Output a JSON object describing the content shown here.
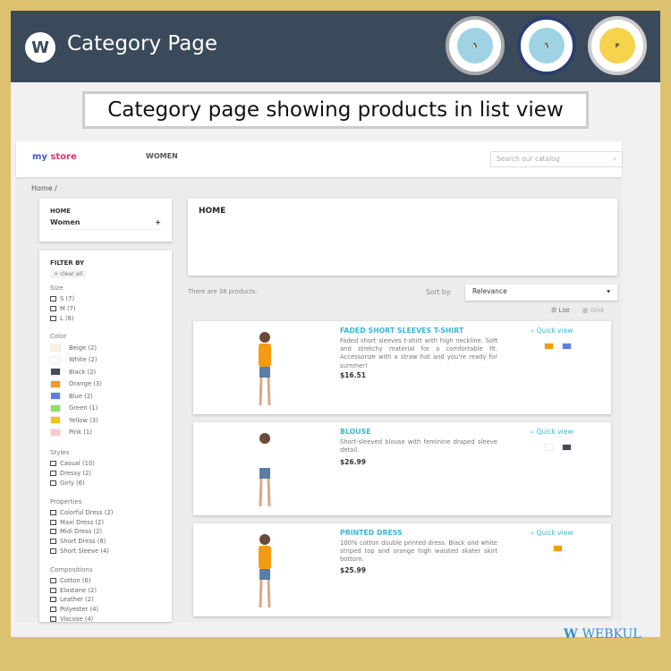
{
  "header": {
    "title": "Category Page",
    "logo": "W",
    "badges": [
      "PrestaShop Partner Silver",
      "PrestaShop Partner Module Developer",
      "PrestaShop Super Hero Seller"
    ]
  },
  "caption": "Category page showing products in list view",
  "store": {
    "brand_a": "my ",
    "brand_b": "store",
    "nav": "WOMEN",
    "search_placeholder": "Search our catalog",
    "breadcrumb": "Home  /"
  },
  "category_block": {
    "title": "HOME",
    "item": "Women",
    "plus": "+"
  },
  "filters": {
    "title": "FILTER BY",
    "clear": "×   clear all",
    "groups": [
      {
        "name": "Size",
        "items": [
          "S (7)",
          "M (7)",
          "L (8)"
        ]
      },
      {
        "name": "Color",
        "items": [
          "Beige (2)",
          "White (2)",
          "Black (2)",
          "Orange (3)",
          "Blue (2)",
          "Green (1)",
          "Yellow (3)",
          "Pink (1)"
        ],
        "colors": [
          "#f5f5dc",
          "#ffffff",
          "#434a54",
          "#f39c11",
          "#5d7ee8",
          "#8dde6b",
          "#f1c40f",
          "#fcc9cc"
        ]
      },
      {
        "name": "Styles",
        "items": [
          "Casual (10)",
          "Dressy (2)",
          "Girly (6)"
        ]
      },
      {
        "name": "Properties",
        "items": [
          "Colorful Dress (2)",
          "Maxi Dress (2)",
          "Midi Dress (2)",
          "Short Dress (6)",
          "Short Sleeve (4)"
        ]
      },
      {
        "name": "Compositions",
        "items": [
          "Cotton (6)",
          "Elastane (2)",
          "Leather (2)",
          "Polyester (4)",
          "Viscose (4)"
        ]
      }
    ]
  },
  "main": {
    "heading": "HOME",
    "count": "There are 38 products.",
    "sort_label": "Sort by:",
    "sort_value": "Relevance",
    "view_list": "List",
    "view_grid": "Grid"
  },
  "products": [
    {
      "name": "FADED SHORT SLEEVES T-SHIRT",
      "desc": "Faded short sleeves t-shirt with high neckline. Soft and stretchy material for a comfortable fit. Accessorize with a straw hat and you're ready for summer!",
      "price": "$16.51",
      "quick": "Quick view",
      "colors": [
        "#f39c11",
        "#5d7ee8"
      ]
    },
    {
      "name": "BLOUSE",
      "desc": "Short-sleeved blouse with feminine draped sleeve detail.",
      "price": "$26.99",
      "quick": "Quick view",
      "colors": [
        "#ffffff",
        "#434a54"
      ]
    },
    {
      "name": "PRINTED DRESS",
      "desc": "100% cotton double printed dress. Black and white striped top and orange high waisted skater skirt bottom.",
      "price": "$25.99",
      "quick": "Quick view",
      "colors": [
        "#f39c11"
      ]
    }
  ],
  "footer": {
    "brand": "WEBKUL"
  }
}
